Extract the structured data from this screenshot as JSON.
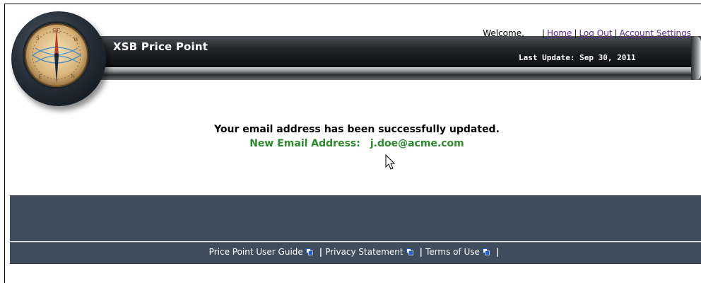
{
  "app": {
    "title": "XSB Price Point"
  },
  "header": {
    "last_update": "Last Update: Sep 30, 2011",
    "welcome": "Welcome,",
    "nav": [
      {
        "label": "Home"
      },
      {
        "label": "Log Out"
      },
      {
        "label": "Account Settings"
      }
    ]
  },
  "main": {
    "message": "Your email address has been successfully updated.",
    "email_label": "New Email Address:",
    "email_value": "j.doe@acme.com"
  },
  "footer": {
    "links": [
      {
        "label": "Price Point User Guide",
        "icon": "external-window-icon"
      },
      {
        "label": "Privacy Statement",
        "icon": "external-window-icon"
      },
      {
        "label": "Terms of Use",
        "icon": "external-window-icon"
      }
    ]
  },
  "colors": {
    "header_dark": "#0c0d0f",
    "footer_band": "#3f4c5c",
    "link_purple": "#5a2d9c",
    "success_green": "#2b8a2b"
  }
}
